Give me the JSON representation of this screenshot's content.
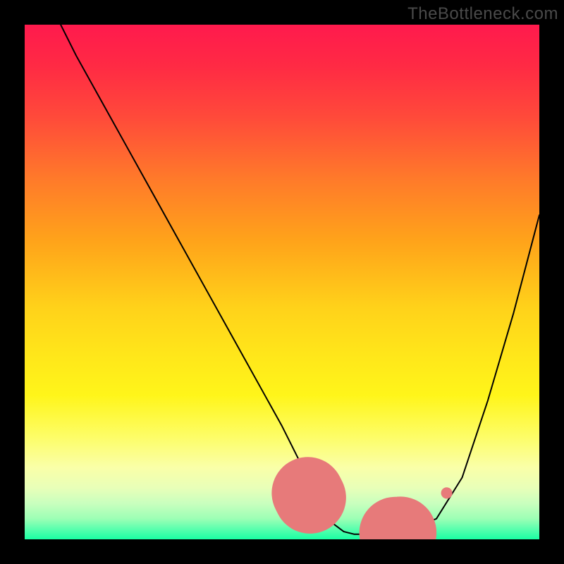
{
  "watermark": "TheBottleneck.com",
  "chart_data": {
    "type": "line",
    "title": "",
    "xlabel": "",
    "ylabel": "",
    "xlim": [
      0,
      100
    ],
    "ylim": [
      0,
      100
    ],
    "series": [
      {
        "name": "bottleneck-curve",
        "x": [
          7,
          10,
          15,
          20,
          25,
          30,
          35,
          40,
          45,
          50,
          52,
          54,
          56,
          58,
          60,
          62,
          64,
          66,
          68,
          70,
          72,
          75,
          80,
          85,
          90,
          95,
          100
        ],
        "y": [
          100,
          94,
          85,
          76,
          67,
          58,
          49,
          40,
          31,
          22,
          18,
          14,
          10,
          6,
          3,
          1.5,
          1,
          1,
          1,
          1.2,
          1.5,
          2,
          4,
          12,
          27,
          44,
          63
        ]
      }
    ],
    "highlight_segment": {
      "name": "optimal-range",
      "x": [
        55,
        57,
        59,
        61,
        63,
        65,
        67,
        69,
        71,
        73,
        75,
        77,
        79,
        81,
        82
      ],
      "y": [
        9,
        5,
        2.5,
        1.5,
        1,
        1,
        1,
        1,
        1.2,
        1.3,
        1.5,
        1.8,
        2.2,
        3,
        9
      ]
    },
    "background_gradient": {
      "orientation": "vertical",
      "stops": [
        {
          "pos": 0.0,
          "color": "#ff1a4d"
        },
        {
          "pos": 0.3,
          "color": "#ff7a2a"
        },
        {
          "pos": 0.6,
          "color": "#ffd21a"
        },
        {
          "pos": 0.85,
          "color": "#faffa8"
        },
        {
          "pos": 1.0,
          "color": "#1affa3"
        }
      ]
    }
  }
}
